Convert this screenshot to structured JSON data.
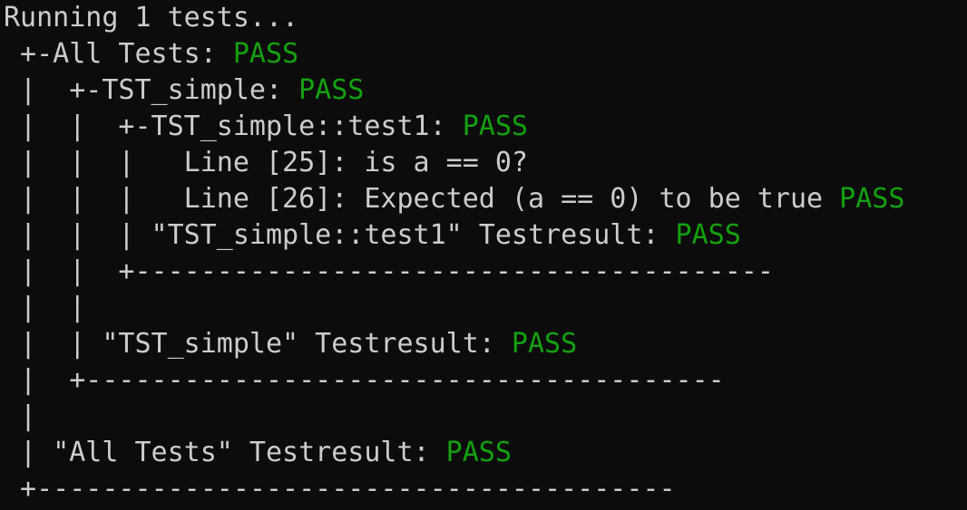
{
  "terminal": {
    "status_color": "#13a10e",
    "text_color": "#cccccc",
    "background_color": "#0c0c0c",
    "lines": [
      {
        "text": "Running 1 tests...",
        "status": ""
      },
      {
        "text": " +-All Tests: ",
        "status": "PASS"
      },
      {
        "text": " |  +-TST_simple: ",
        "status": "PASS"
      },
      {
        "text": " |  |  +-TST_simple::test1: ",
        "status": "PASS"
      },
      {
        "text": " |  |  |   Line [25]: is a == 0?",
        "status": ""
      },
      {
        "text": " |  |  |   Line [26]: Expected (a == 0) to be true ",
        "status": "PASS"
      },
      {
        "text": " |  |  | \"TST_simple::test1\" Testresult: ",
        "status": "PASS"
      },
      {
        "text": " |  |  +---------------------------------------",
        "status": ""
      },
      {
        "text": " |  |",
        "status": ""
      },
      {
        "text": " |  | \"TST_simple\" Testresult: ",
        "status": "PASS"
      },
      {
        "text": " |  +---------------------------------------",
        "status": ""
      },
      {
        "text": " |",
        "status": ""
      },
      {
        "text": " | \"All Tests\" Testresult: ",
        "status": "PASS"
      },
      {
        "text": " +---------------------------------------",
        "status": ""
      }
    ]
  }
}
